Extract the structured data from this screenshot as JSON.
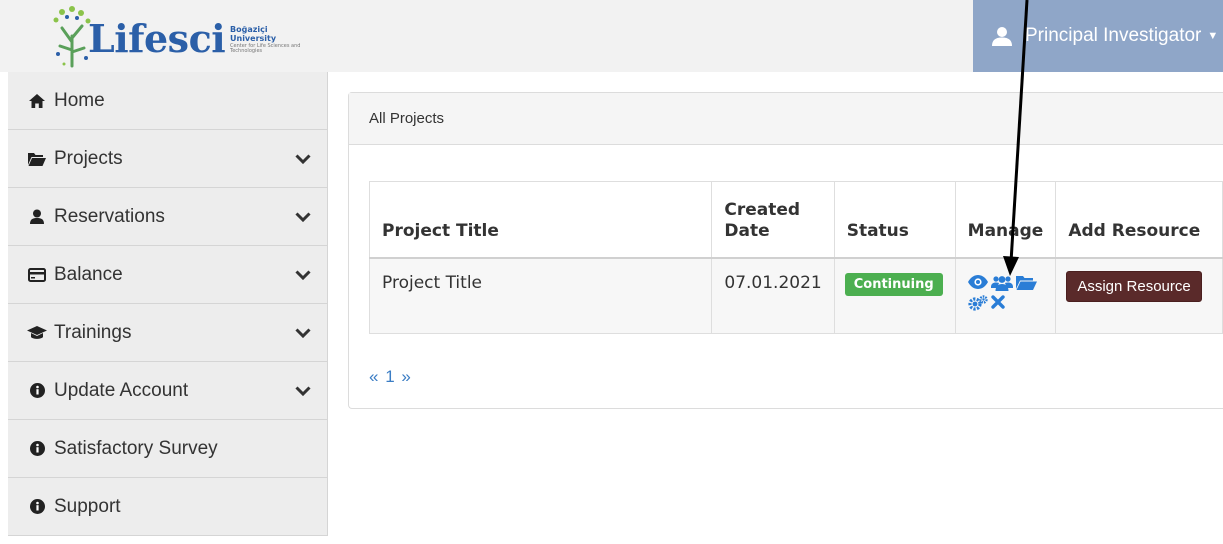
{
  "header": {
    "logo_text": "Lifesci",
    "logo_university": "Boğaziçi University",
    "logo_center": "Center for Life Sciences and Technologies",
    "user_label": "Principal Investigator"
  },
  "sidebar": {
    "items": [
      {
        "label": "Home",
        "icon": "home-icon",
        "has_chevron": false
      },
      {
        "label": "Projects",
        "icon": "folder-open-icon",
        "has_chevron": true
      },
      {
        "label": "Reservations",
        "icon": "user-icon",
        "has_chevron": true
      },
      {
        "label": "Balance",
        "icon": "credit-card-icon",
        "has_chevron": true
      },
      {
        "label": "Trainings",
        "icon": "graduation-cap-icon",
        "has_chevron": true
      },
      {
        "label": "Update Account",
        "icon": "info-circle-icon",
        "has_chevron": true
      },
      {
        "label": "Satisfactory Survey",
        "icon": "info-circle-icon",
        "has_chevron": false
      },
      {
        "label": "Support",
        "icon": "info-circle-icon",
        "has_chevron": false
      }
    ]
  },
  "panel": {
    "heading": "All Projects",
    "columns": [
      "Project Title",
      "Created Date",
      "Status",
      "Manage",
      "Add Resource"
    ],
    "rows": [
      {
        "title": "Project Title",
        "created_date": "07.01.2021",
        "status": "Continuing",
        "manage_icons": [
          "eye-icon",
          "users-icon",
          "folder-open-icon",
          "gears-icon",
          "times-icon"
        ],
        "action_label": "Assign Resource"
      }
    ],
    "pagination": {
      "prev": "«",
      "page": "1",
      "next": "»"
    }
  },
  "colors": {
    "header_bg": "#f2f2f2",
    "user_menu_bg": "#8fa6c8",
    "logo_blue": "#2b5fa8",
    "status_green": "#4caf50",
    "assign_button": "#5a2a2a",
    "link_blue": "#3b7dc4",
    "manage_icon_blue": "#2a7dd6"
  },
  "annotation": {
    "arrow_target": "users-icon"
  }
}
